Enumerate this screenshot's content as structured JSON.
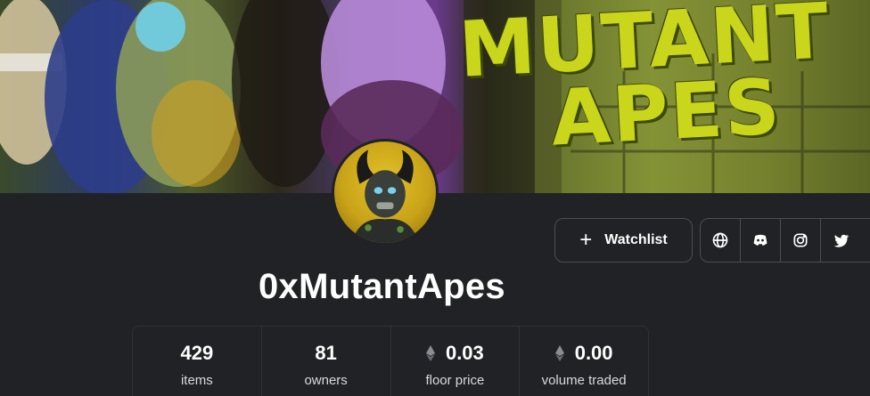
{
  "banner": {
    "title_line1": "MUTANT",
    "title_line2": "APES"
  },
  "collection": {
    "name": "0xMutantApes"
  },
  "actions": {
    "watchlist_label": "Watchlist"
  },
  "social_links": [
    {
      "icon": "globe-icon"
    },
    {
      "icon": "discord-icon"
    },
    {
      "icon": "instagram-icon"
    },
    {
      "icon": "twitter-icon"
    }
  ],
  "stats": [
    {
      "value": "429",
      "label": "items",
      "currency_icon": ""
    },
    {
      "value": "81",
      "label": "owners",
      "currency_icon": ""
    },
    {
      "value": "0.03",
      "label": "floor price",
      "currency_icon": "ethereum-icon"
    },
    {
      "value": "0.00",
      "label": "volume traded",
      "currency_icon": "ethereum-icon"
    }
  ],
  "colors": {
    "background": "#202225",
    "border": "#4a4d52",
    "banner_title": "#c9d61c"
  }
}
